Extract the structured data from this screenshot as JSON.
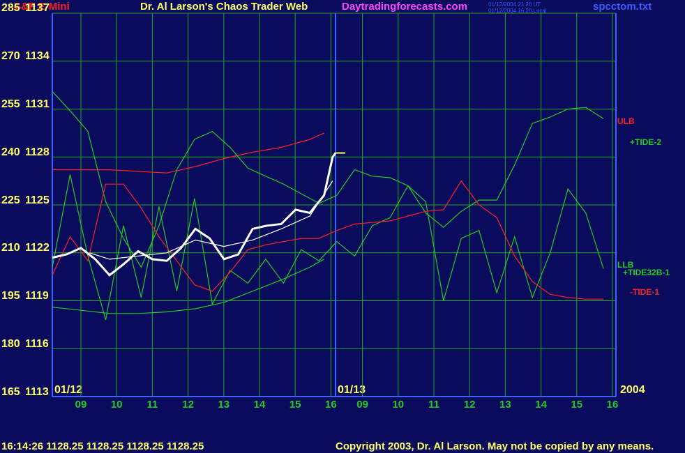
{
  "header": {
    "instrument": "S&P E-Mini",
    "site_title": "Dr. Al Larson's Chaos Trader Web",
    "site_url": "Daytradingforecasts.com",
    "timestamp_ut": "01/12/2004 21:20 UT",
    "timestamp_local": "01/12/2004 16:20 Local",
    "filename": "spcctom.txt"
  },
  "footer": {
    "quote": "16:14:26  1128.25 1128.25 1128.25 1128.25",
    "copyright": "Copyright 2003, Dr. Al Larson. May not be copied by any means."
  },
  "colors": {
    "background": "#0b0b5e",
    "grid": "#1fa81f",
    "axis": "#4060ff",
    "yellow": "#ffff66",
    "red": "#ff2020",
    "green": "#22cc22",
    "magenta": "#ff44ff",
    "white": "#ffffff"
  },
  "chart_data": {
    "type": "line",
    "title": "S&P E-Mini",
    "y_left_labels": [
      "285",
      "270",
      "255",
      "240",
      "225",
      "210",
      "195",
      "180",
      "165"
    ],
    "y_price_labels": [
      "1137",
      "1134",
      "1131",
      "1128",
      "1125",
      "1122",
      "1119",
      "1116",
      "1113"
    ],
    "ylim": [
      1113,
      1137
    ],
    "x_day1_label": "01/12",
    "x_day2_label": "01/13",
    "x_year_label": "2004",
    "x_hour_labels": [
      "09",
      "10",
      "11",
      "12",
      "13",
      "14",
      "15",
      "16",
      "09",
      "10",
      "11",
      "12",
      "13",
      "14",
      "15",
      "16"
    ],
    "legend": {
      "ulb": "ULB",
      "tide2": "+TIDE-2",
      "llb": "LLB",
      "tide32b": "+TIDE32B-1",
      "tide1": "-TIDE-1"
    },
    "last_price": 1128.25,
    "series": [
      {
        "name": "ULB",
        "color": "#ff2020",
        "points": [
          [
            0,
            1127.2
          ],
          [
            1,
            1127.2
          ],
          [
            2,
            1127.2
          ],
          [
            3,
            1127.1
          ],
          [
            4,
            1127.0
          ],
          [
            5,
            1127.4
          ],
          [
            6,
            1127.9
          ],
          [
            7,
            1128.3
          ],
          [
            8,
            1128.6
          ],
          [
            9,
            1129.1
          ],
          [
            9.5,
            1129.5
          ]
        ]
      },
      {
        "name": "LLB",
        "color": "#22cc22",
        "points": [
          [
            0,
            1118.6
          ],
          [
            1,
            1118.4
          ],
          [
            2,
            1118.2
          ],
          [
            3,
            1118.2
          ],
          [
            4,
            1118.3
          ],
          [
            5,
            1118.5
          ],
          [
            6,
            1118.9
          ],
          [
            7,
            1119.6
          ],
          [
            8,
            1120.3
          ],
          [
            9,
            1121.1
          ],
          [
            9.5,
            1121.6
          ]
        ]
      },
      {
        "name": "+TIDE-2",
        "color": "#22cc22",
        "points": [
          [
            0,
            1132.1
          ],
          [
            1,
            1130.9
          ],
          [
            2,
            1129.6
          ],
          [
            3,
            1125.2
          ],
          [
            4,
            1122.9
          ],
          [
            5,
            1121.1
          ],
          [
            6,
            1123.7
          ],
          [
            7,
            1127.2
          ],
          [
            8,
            1129.1
          ],
          [
            9,
            1129.6
          ],
          [
            10,
            1128.6
          ],
          [
            11,
            1127.3
          ],
          [
            12,
            1126.8
          ],
          [
            13,
            1126.3
          ],
          [
            14,
            1125.7
          ],
          [
            15,
            1125.1
          ],
          [
            16,
            1125.6
          ],
          [
            17,
            1127.2
          ],
          [
            18,
            1126.8
          ],
          [
            19,
            1126.7
          ],
          [
            20,
            1126.2
          ],
          [
            21,
            1124.5
          ],
          [
            22,
            1123.6
          ],
          [
            23,
            1124.6
          ],
          [
            24,
            1125.3
          ],
          [
            25,
            1125.3
          ],
          [
            26,
            1127.5
          ],
          [
            27,
            1130.1
          ],
          [
            28,
            1130.5
          ],
          [
            29,
            1131.0
          ],
          [
            30,
            1131.1
          ],
          [
            31,
            1130.4
          ]
        ]
      },
      {
        "name": "+TIDE32B-1",
        "color": "#22cc22",
        "points": [
          [
            0,
            1121.1
          ],
          [
            1,
            1126.9
          ],
          [
            2,
            1121.8
          ],
          [
            3,
            1117.8
          ],
          [
            4,
            1123.7
          ],
          [
            5,
            1119.2
          ],
          [
            6,
            1124.9
          ],
          [
            7,
            1119.6
          ],
          [
            8,
            1125.4
          ],
          [
            9,
            1118.8
          ],
          [
            10,
            1120.9
          ],
          [
            11,
            1120.1
          ],
          [
            12,
            1121.6
          ],
          [
            13,
            1120.1
          ],
          [
            14,
            1122.2
          ],
          [
            15,
            1121.5
          ],
          [
            16,
            1122.7
          ],
          [
            17,
            1121.8
          ],
          [
            18,
            1123.7
          ],
          [
            19,
            1124.2
          ],
          [
            20,
            1126.2
          ],
          [
            21,
            1125.2
          ],
          [
            22,
            1119.0
          ],
          [
            23,
            1122.9
          ],
          [
            24,
            1123.4
          ],
          [
            25,
            1119.5
          ],
          [
            26,
            1123.0
          ],
          [
            27,
            1119.2
          ],
          [
            28,
            1122.0
          ],
          [
            29,
            1126.0
          ],
          [
            30,
            1124.5
          ],
          [
            31,
            1121.0
          ]
        ]
      },
      {
        "name": "-TIDE-1",
        "color": "#ff2020",
        "points": [
          [
            0,
            1120.6
          ],
          [
            1,
            1123.0
          ],
          [
            2,
            1121.5
          ],
          [
            3,
            1126.3
          ],
          [
            4,
            1126.3
          ],
          [
            5,
            1124.8
          ],
          [
            6,
            1123.0
          ],
          [
            7,
            1121.5
          ],
          [
            8,
            1120.0
          ],
          [
            9,
            1119.6
          ],
          [
            10,
            1120.8
          ],
          [
            11,
            1122.2
          ],
          [
            12,
            1122.5
          ],
          [
            13,
            1122.7
          ],
          [
            14,
            1122.9
          ],
          [
            15,
            1122.9
          ],
          [
            16,
            1123.4
          ],
          [
            17,
            1123.8
          ],
          [
            18,
            1123.9
          ],
          [
            19,
            1124.0
          ],
          [
            20,
            1124.3
          ],
          [
            21,
            1124.6
          ],
          [
            22,
            1124.7
          ],
          [
            23,
            1126.5
          ],
          [
            24,
            1125.0
          ],
          [
            25,
            1124.2
          ],
          [
            26,
            1121.8
          ],
          [
            27,
            1120.2
          ],
          [
            28,
            1119.4
          ],
          [
            29,
            1119.2
          ],
          [
            30,
            1119.1
          ],
          [
            31,
            1119.1
          ]
        ]
      },
      {
        "name": "price",
        "color": "#ffffff",
        "points": [
          [
            0,
            1121.7
          ],
          [
            0.5,
            1121.9
          ],
          [
            1,
            1122.3
          ],
          [
            1.5,
            1121.6
          ],
          [
            2,
            1120.6
          ],
          [
            2.5,
            1121.3
          ],
          [
            3,
            1122.1
          ],
          [
            3.5,
            1121.6
          ],
          [
            4,
            1121.5
          ],
          [
            4.5,
            1122.3
          ],
          [
            5,
            1123.5
          ],
          [
            5.5,
            1122.9
          ],
          [
            6,
            1121.6
          ],
          [
            6.5,
            1121.9
          ],
          [
            7,
            1123.5
          ],
          [
            7.5,
            1123.7
          ],
          [
            8,
            1123.8
          ],
          [
            8.5,
            1124.7
          ],
          [
            9,
            1124.5
          ],
          [
            9.5,
            1125.6
          ],
          [
            9.8,
            1128.0
          ],
          [
            9.9,
            1128.25
          ]
        ]
      },
      {
        "name": "average",
        "color": "#ffffff",
        "points": [
          [
            1.3,
            1122.0
          ],
          [
            2,
            1121.6
          ],
          [
            3,
            1121.8
          ],
          [
            4,
            1122.0
          ],
          [
            5,
            1122.8
          ],
          [
            6,
            1122.4
          ],
          [
            7,
            1122.8
          ],
          [
            8,
            1123.5
          ],
          [
            9,
            1124.3
          ],
          [
            9.8,
            1126.5
          ]
        ]
      }
    ]
  }
}
